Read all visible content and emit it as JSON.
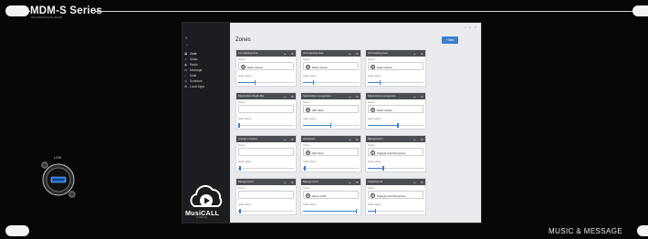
{
  "device": {
    "series_title": "MDM-S Series",
    "series_subtitle": "MULTIZONE DIGITAL MIXER",
    "footer_text": "MUSIC & MESSAGE",
    "usb_label": "USB"
  },
  "app": {
    "page_title": "Zones",
    "new_button_label": "+ New",
    "window_controls": [
      "—",
      "□",
      "×"
    ],
    "menu_icon": "≡",
    "back_icon": "←",
    "brand_logo_text": "MusiCALL",
    "brand_logo_sub": "by Mercury",
    "nav": [
      {
        "icon": "zones-icon",
        "glyph": "▣",
        "label": "Zone"
      },
      {
        "icon": "music-icon",
        "glyph": "♫",
        "label": "Music"
      },
      {
        "icon": "radio-icon",
        "glyph": "◉",
        "label": "Radio"
      },
      {
        "icon": "message-icon",
        "glyph": "✉",
        "label": "Message"
      },
      {
        "icon": "sound-icon",
        "glyph": "♪",
        "label": "Mute"
      },
      {
        "icon": "schedule-icon",
        "glyph": "◷",
        "label": "Schedule"
      },
      {
        "icon": "settings-icon",
        "glyph": "⚙",
        "label": "Local Apps"
      }
    ],
    "labels": {
      "source": "Source",
      "audio_volume": "Audio volume"
    },
    "accent_color": "#3d7fcb"
  },
  "zones": [
    {
      "name": "1st Listening Area",
      "source": "Radio Stream",
      "source_icon": "radio-icon",
      "volume_percent": 30
    },
    {
      "name": "2nd Listening Area",
      "source": "Radio Stream",
      "source_icon": "radio-icon",
      "volume_percent": 19
    },
    {
      "name": "3rd Listening Area",
      "source": "Radio Stream",
      "source_icon": "radio-icon",
      "volume_percent": 22
    },
    {
      "name": "Stand-Alone Studio Mix",
      "source": "",
      "source_icon": "",
      "volume_percent": 2
    },
    {
      "name": "Stand-Alone Loungezone",
      "source": "WiFi Stick",
      "source_icon": "radio-icon",
      "volume_percent": 50
    },
    {
      "name": "Stand-Alone Loungezone",
      "source": "Radio Stream",
      "source_icon": "radio-icon",
      "volume_percent": 54
    },
    {
      "name": "Lounge + Terrace",
      "source": "",
      "source_icon": "",
      "volume_percent": 3
    },
    {
      "name": "Restaurant",
      "source": "WiFi Stick",
      "source_icon": "radio-icon",
      "volume_percent": 3
    },
    {
      "name": "Background 1",
      "source": "Paging/Local Microphone",
      "source_icon": "mic-icon",
      "volume_percent": 28
    },
    {
      "name": "Background 2",
      "source": "",
      "source_icon": "",
      "volume_percent": 3
    },
    {
      "name": "Background 3",
      "source": "Stereo 1/2/3",
      "source_icon": "radio-icon",
      "volume_percent": 96
    },
    {
      "name": "Telephone Air",
      "source": "Paging/Local Microphone",
      "source_icon": "mic-icon",
      "volume_percent": 14
    }
  ]
}
